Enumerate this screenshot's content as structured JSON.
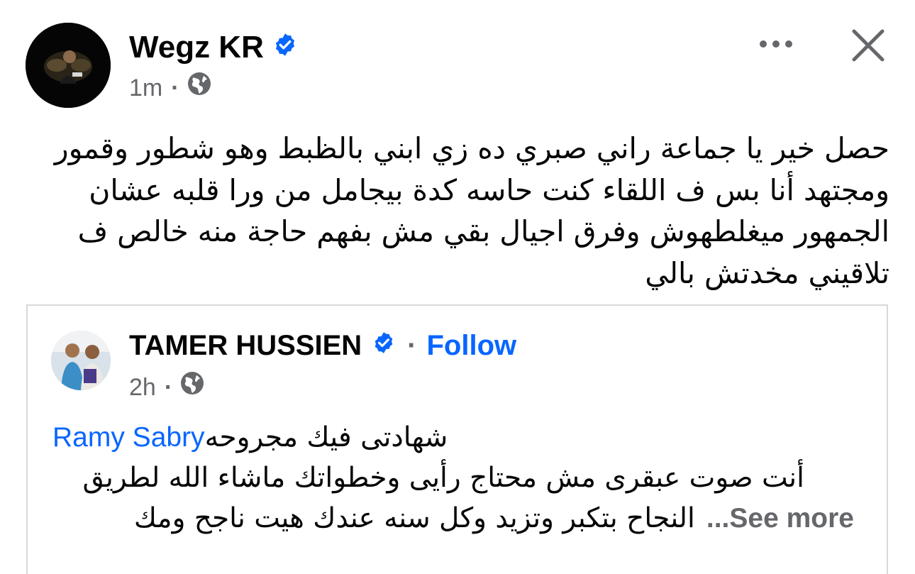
{
  "post": {
    "author": "Wegz KR",
    "time": "1m",
    "separator": "·",
    "text": "حصل خير يا جماعة راني صبري ده زي ابني بالظبط وهو شطور وقمور ومجتهد أنا بس ف اللقاء كنت حاسه كدة بيجامل من ورا قلبه عشان الجمهور ميغلطهوش وفرق اجيال بقي مش بفهم حاجة منه خالص ف تلاقيني مخدتش بالي"
  },
  "icons": {
    "verified": "verified-badge-icon",
    "globe": "globe-icon",
    "more": "more-options-icon",
    "close": "close-icon"
  },
  "shared": {
    "author": "TAMER HUSSIEN",
    "separator": "·",
    "follow_label": "Follow",
    "time": "2h",
    "line1_text": "شهادتى فيك مجروحه",
    "mention": "Ramy Sabry",
    "line2_text": "أنت صوت عبقرى مش محتاج رأيى وخطواتك ماشاء الله لطريق",
    "line3_text": "النجاح بتكبر وتزيد  وكل سنه عندك هيت ناجح ومك",
    "see_more": "...See more"
  },
  "colors": {
    "accent": "#0866ff",
    "secondary_text": "#65676b",
    "primary_text": "#050505",
    "card_border": "#d6d8dc"
  }
}
